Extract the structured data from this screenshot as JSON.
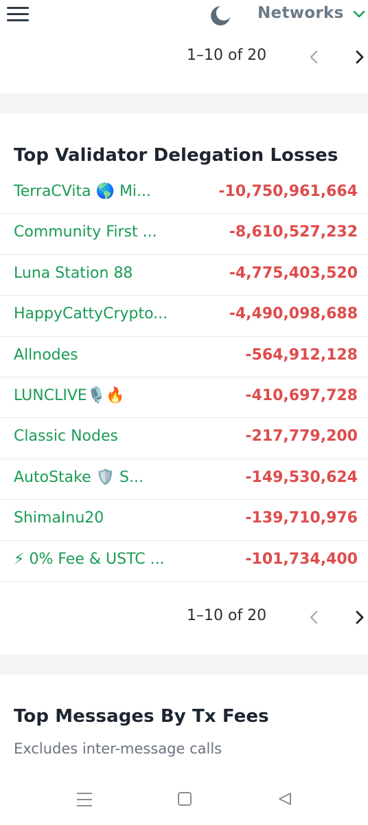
{
  "header": {
    "menu_icon": "hamburger-menu-icon",
    "theme_icon": "moon-icon",
    "networks_label": "Networks",
    "networks_chevron_icon": "chevron-down-icon",
    "accent_color": "#1a9b55"
  },
  "top_pager": {
    "label": "1–10 of 20",
    "prev_icon": "chevron-left-icon",
    "next_icon": "chevron-right-icon"
  },
  "losses": {
    "title": "Top Validator Delegation Losses",
    "name_color": "#1a9b55",
    "value_color": "#de4c4c",
    "rows": [
      {
        "name": "TerraCVita 🌎 Mi...",
        "value": "-10,750,961,664"
      },
      {
        "name": "Community First ...",
        "value": "-8,610,527,232"
      },
      {
        "name": "Luna Station 88",
        "value": "-4,775,403,520"
      },
      {
        "name": "HappyCattyCrypto...",
        "value": "-4,490,098,688"
      },
      {
        "name": "Allnodes",
        "value": "-564,912,128"
      },
      {
        "name": "LUNCLIVE🎙️🔥",
        "value": "-410,697,728"
      },
      {
        "name": "Classic Nodes",
        "value": "-217,779,200"
      },
      {
        "name": "AutoStake 🛡️ S...",
        "value": "-149,530,624"
      },
      {
        "name": "ShimaInu20",
        "value": "-139,710,976"
      },
      {
        "name": "⚡ 0% Fee & USTC ...",
        "value": "-101,734,400"
      }
    ],
    "pager": {
      "label": "1–10 of 20",
      "prev_icon": "chevron-left-icon",
      "next_icon": "chevron-right-icon"
    }
  },
  "messages": {
    "title": "Top Messages By Tx Fees",
    "subtitle": "Excludes inter-message calls"
  },
  "system_nav": {
    "recent_icon": "recent-apps-icon",
    "home_icon": "home-icon",
    "back_icon": "back-icon"
  }
}
